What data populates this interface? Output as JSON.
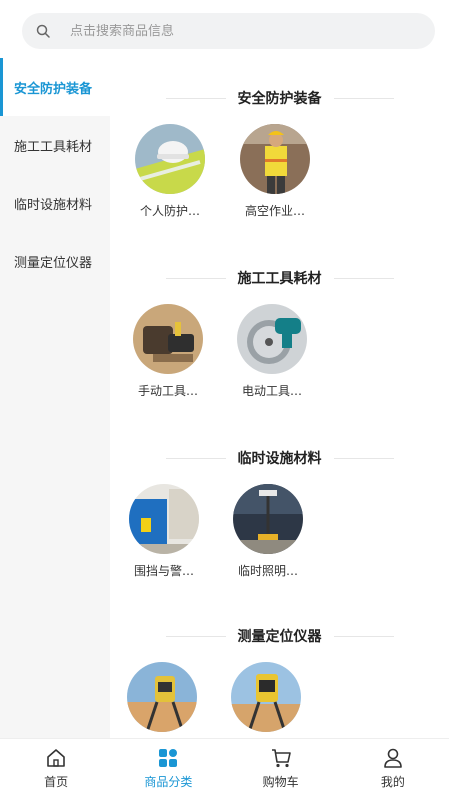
{
  "search": {
    "placeholder": "点击搜索商品信息",
    "icon": "search-icon"
  },
  "sidebar": {
    "items": [
      {
        "label": "安全防护装备",
        "active": true
      },
      {
        "label": "施工工具耗材",
        "active": false
      },
      {
        "label": "临时设施材料",
        "active": false
      },
      {
        "label": "测量定位仪器",
        "active": false
      }
    ]
  },
  "sections": [
    {
      "title": "安全防护装备",
      "items": [
        {
          "label": "个人防护…"
        },
        {
          "label": "高空作业…"
        }
      ]
    },
    {
      "title": "施工工具耗材",
      "items": [
        {
          "label": "手动工具…"
        },
        {
          "label": "电动工具…"
        }
      ]
    },
    {
      "title": "临时设施材料",
      "items": [
        {
          "label": "围挡与警…"
        },
        {
          "label": "临时照明…"
        }
      ]
    },
    {
      "title": "测量定位仪器",
      "items": [
        {
          "label": ""
        },
        {
          "label": ""
        }
      ]
    }
  ],
  "tabbar": {
    "tabs": [
      {
        "label": "首页",
        "icon": "home-icon"
      },
      {
        "label": "商品分类",
        "icon": "category-icon",
        "active": true
      },
      {
        "label": "购物车",
        "icon": "cart-icon"
      },
      {
        "label": "我的",
        "icon": "user-icon"
      }
    ]
  },
  "colors": {
    "accent": "#1a96d4",
    "sidebar_bg": "#f6f6f6",
    "search_bg": "#f1f2f3"
  }
}
